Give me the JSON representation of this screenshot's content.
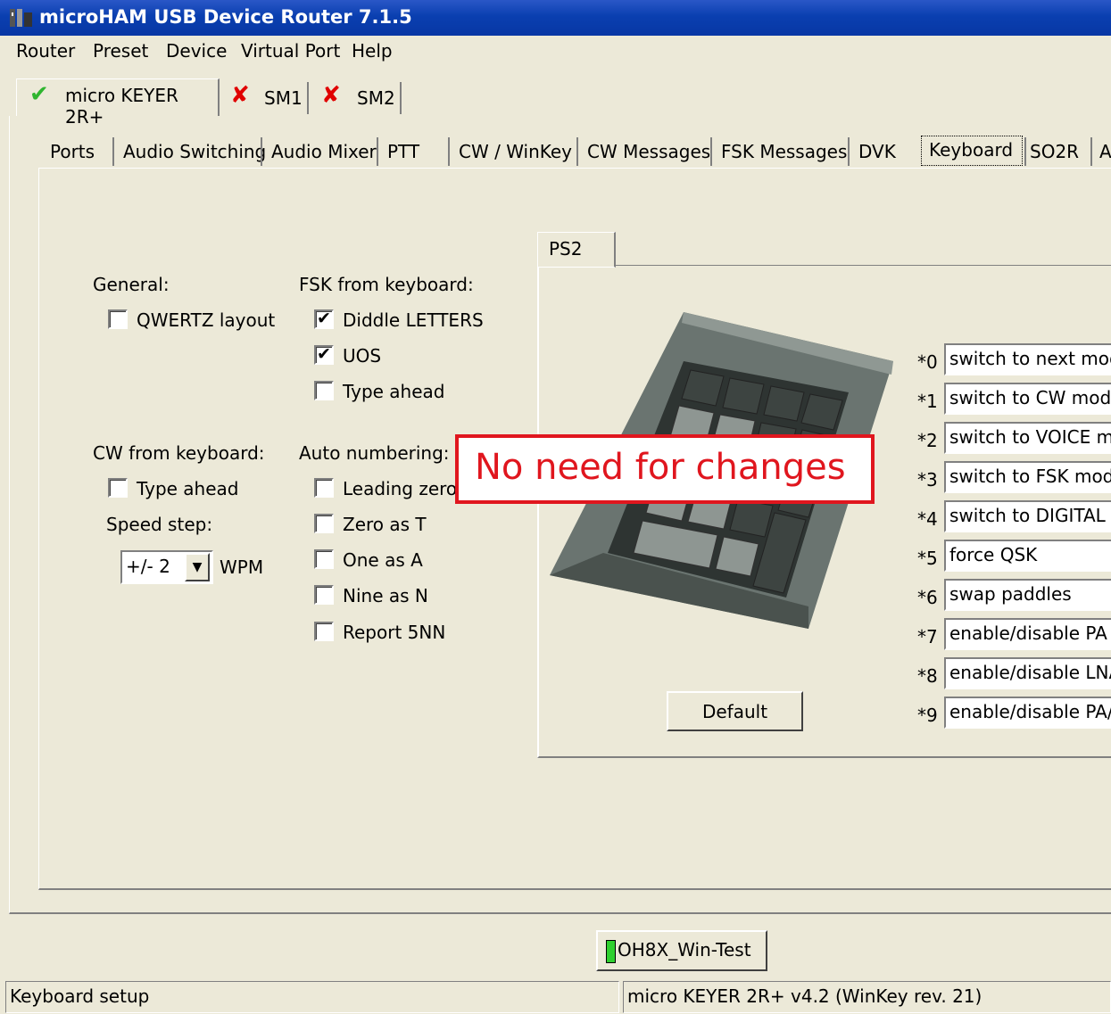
{
  "window": {
    "title": "microHAM USB Device Router 7.1.5"
  },
  "menu": [
    "Router",
    "Preset",
    "Device",
    "Virtual Port",
    "Help"
  ],
  "device_tabs": [
    {
      "label": "micro KEYER 2R+",
      "status": "connected"
    },
    {
      "label": "SM1",
      "status": "error"
    },
    {
      "label": "SM2",
      "status": "error"
    }
  ],
  "tabs": [
    "Ports",
    "Audio Switching",
    "Audio Mixer",
    "PTT",
    "CW / WinKey",
    "CW Messages",
    "FSK Messages",
    "DVK",
    "Keyboard",
    "SO2R",
    "A"
  ],
  "active_tab": "Keyboard",
  "general": {
    "heading": "General:",
    "qwertz_label": "QWERTZ layout",
    "qwertz_checked": false
  },
  "fsk": {
    "heading": "FSK from keyboard:",
    "items": [
      {
        "label": "Diddle LETTERS",
        "checked": true
      },
      {
        "label": "UOS",
        "checked": true
      },
      {
        "label": "Type ahead",
        "checked": false
      }
    ]
  },
  "cw": {
    "heading": "CW from keyboard:",
    "type_ahead_label": "Type ahead",
    "type_ahead_checked": false,
    "speed_step_label": "Speed step:",
    "speed_step_value": "+/- 2",
    "unit": "WPM"
  },
  "auto_numbering": {
    "heading": "Auto numbering:",
    "items": [
      {
        "label": "Leading zero",
        "checked": false
      },
      {
        "label": "Zero as T",
        "checked": false
      },
      {
        "label": "One as A",
        "checked": false
      },
      {
        "label": "Nine as N",
        "checked": false
      },
      {
        "label": "Report 5NN",
        "checked": false
      }
    ]
  },
  "ps2": {
    "tab_label": "PS2",
    "default_button": "Default",
    "macros": [
      {
        "key": "*0",
        "value": "switch to next mode"
      },
      {
        "key": "*1",
        "value": "switch to CW mode"
      },
      {
        "key": "*2",
        "value": "switch to VOICE mode"
      },
      {
        "key": "*3",
        "value": "switch to FSK mode"
      },
      {
        "key": "*4",
        "value": "switch to DIGITAL mode"
      },
      {
        "key": "*5",
        "value": "force QSK"
      },
      {
        "key": "*6",
        "value": "swap paddles"
      },
      {
        "key": "*7",
        "value": "enable/disable PA PTT"
      },
      {
        "key": "*8",
        "value": "enable/disable LNA PTT"
      },
      {
        "key": "*9",
        "value": "enable/disable PA/LNA"
      }
    ]
  },
  "callout": "No need for changes",
  "preset_button": "OH8X_Win-Test",
  "status": {
    "left": "Keyboard setup",
    "right": "micro KEYER 2R+ v4.2 (WinKey rev. 21)"
  },
  "colors": {
    "titlebar": "#0a3fb0",
    "callout": "#e0161e",
    "ok": "#2fb52f",
    "error": "#e00000"
  }
}
